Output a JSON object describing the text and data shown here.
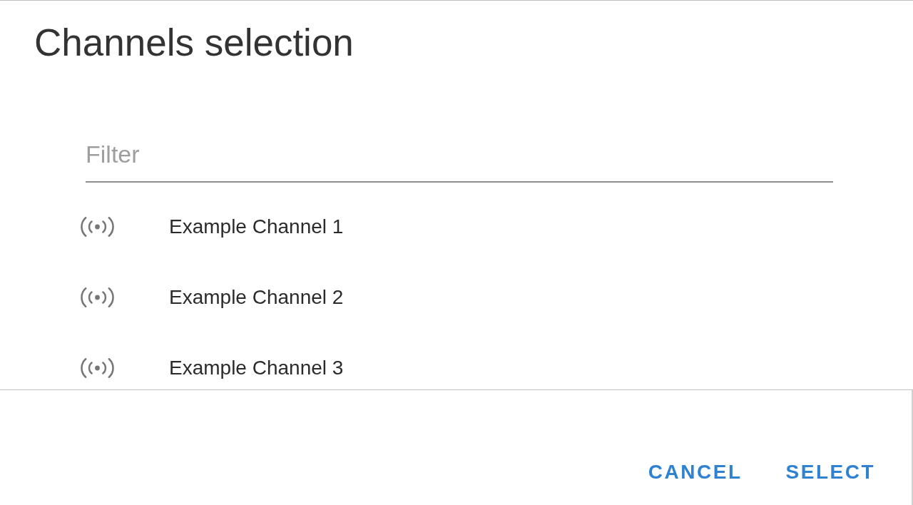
{
  "dialog": {
    "title": "Channels selection"
  },
  "filter": {
    "placeholder": "Filter"
  },
  "channels": [
    {
      "name": "Example Channel 1"
    },
    {
      "name": "Example Channel 2"
    },
    {
      "name": "Example Channel 3"
    }
  ],
  "buttons": [
    {
      "label": "CANCEL"
    },
    {
      "label": "SELECT"
    }
  ]
}
